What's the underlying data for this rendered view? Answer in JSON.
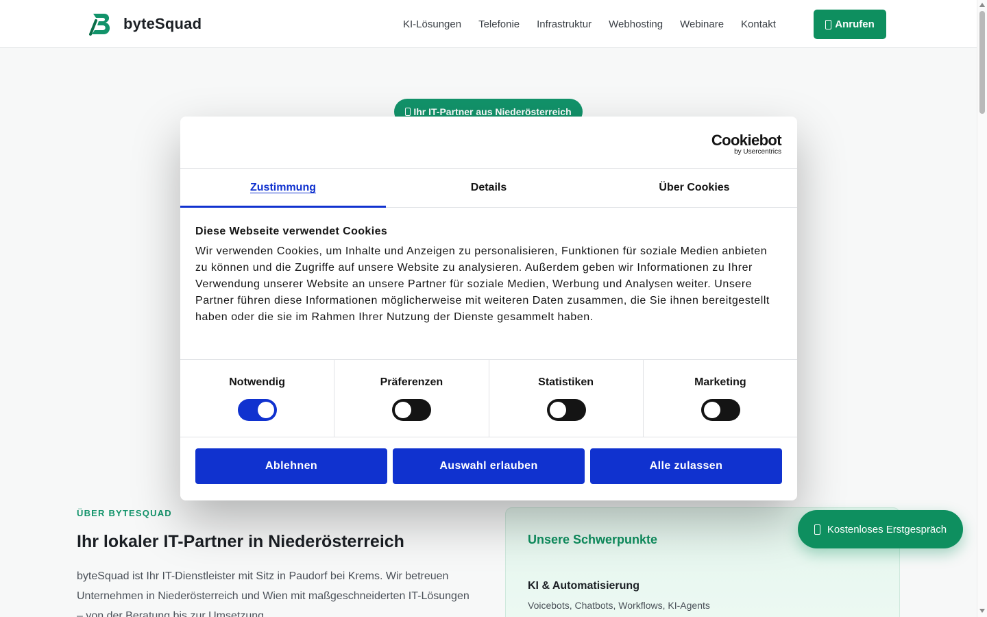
{
  "colors": {
    "brand_green": "#0e8f5f",
    "cookie_blue": "#1032cf",
    "toggle_off": "#141414"
  },
  "header": {
    "logo_text": "byteSquad",
    "nav": [
      "KI-Lösungen",
      "Telefonie",
      "Infrastruktur",
      "Webhosting",
      "Webinare",
      "Kontakt"
    ],
    "call_label": "Anrufen",
    "call_icon": "phone-icon"
  },
  "hero": {
    "pill_label": "Ihr IT-Partner aus Niederösterreich",
    "pill_icon": "location-icon"
  },
  "about": {
    "eyebrow": "ÜBER BYTESQUAD",
    "title": "Ihr lokaler IT-Partner in Niederösterreich",
    "text": "byteSquad ist Ihr IT-Dienstleister mit Sitz in Paudorf bei Krems. Wir betreuen Unternehmen in Niederösterreich und Wien mit maßgeschneiderten IT-Lösungen – von der Beratung bis zur Umsetzung."
  },
  "focus": {
    "title": "Unsere Schwerpunkte",
    "item_title": "KI & Automatisierung",
    "item_sub": "Voicebots, Chatbots, Workflows, KI-Agents"
  },
  "cookie": {
    "brand": "Cookiebot",
    "brand_sub": "by Usercentrics",
    "tabs": [
      "Zustimmung",
      "Details",
      "Über Cookies"
    ],
    "active_tab": "Zustimmung",
    "heading": "Diese Webseite verwendet Cookies",
    "text": "Wir verwenden Cookies, um Inhalte und Anzeigen zu personalisieren, Funktionen für soziale Medien anbieten zu können und die Zugriffe auf unsere Website zu analysieren. Außerdem geben wir Informationen zu Ihrer Verwendung unserer Website an unsere Partner für soziale Medien, Werbung und Analysen weiter. Unsere Partner führen diese Informationen möglicherweise mit weiteren Daten zusammen, die Sie ihnen bereitgestellt haben oder die sie im Rahmen Ihrer Nutzung der Dienste gesammelt haben.",
    "toggles": [
      {
        "label": "Notwendig",
        "on": true
      },
      {
        "label": "Präferenzen",
        "on": false
      },
      {
        "label": "Statistiken",
        "on": false
      },
      {
        "label": "Marketing",
        "on": false
      }
    ],
    "buttons": [
      "Ablehnen",
      "Auswahl erlauben",
      "Alle zulassen"
    ]
  },
  "floating_cta": {
    "label": "Kostenloses Erstgespräch",
    "icon": "phone-icon"
  }
}
